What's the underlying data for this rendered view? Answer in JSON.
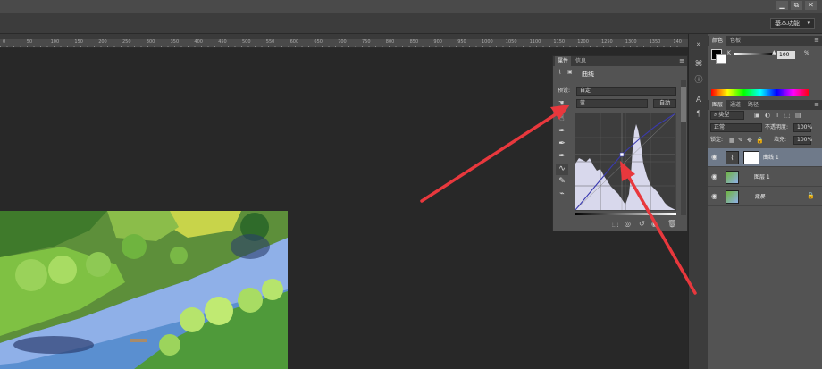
{
  "window": {
    "minimize": "▁",
    "restore": "⧉",
    "close": "✕"
  },
  "options_bar": {
    "workspace": "基本功能"
  },
  "ruler": {
    "ticks": [
      "0",
      "50",
      "100",
      "150",
      "200",
      "250",
      "300",
      "350",
      "400",
      "450",
      "500",
      "550",
      "600",
      "650",
      "700",
      "750",
      "800",
      "850",
      "900",
      "950",
      "1000",
      "1050",
      "1100",
      "1150",
      "1200",
      "1250",
      "1300",
      "1350",
      "140"
    ]
  },
  "color_panel": {
    "tabs": [
      "颜色",
      "色板"
    ],
    "channel": "K",
    "value": "100",
    "unit": "%"
  },
  "layers_panel": {
    "tabs": [
      "图层",
      "通道",
      "路径"
    ],
    "filter_kind": "类型",
    "blend_mode": "正常",
    "opacity_label": "不透明度:",
    "opacity_value": "100%",
    "lock_label": "锁定:",
    "fill_label": "填充:",
    "fill_value": "100%",
    "layers": [
      {
        "name": "曲线 1",
        "selected": true
      },
      {
        "name": "图层 1",
        "selected": false
      },
      {
        "name": "背景",
        "selected": false
      }
    ]
  },
  "properties_panel": {
    "tabs": [
      "属性",
      "信息"
    ],
    "title": "曲线",
    "preset_label": "预设:",
    "preset_value": "自定",
    "channel_value": "蓝",
    "auto_button": "自动"
  },
  "colors": {
    "accent_arrow": "#e8383d",
    "curve_line": "#3a3ab0",
    "histogram_fill": "#d8d8ec"
  }
}
